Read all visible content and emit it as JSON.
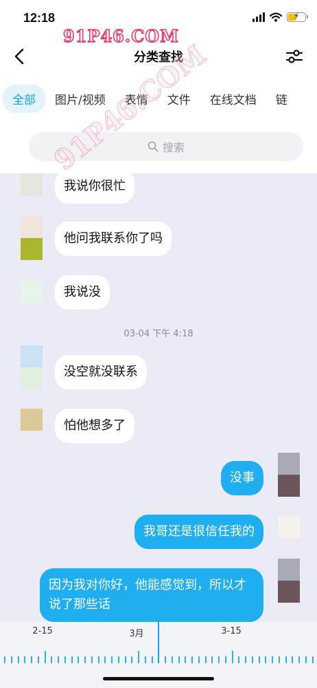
{
  "status_bar": {
    "time": "12:18"
  },
  "watermark": "91P46.COM",
  "header": {
    "title": "分类查找"
  },
  "tabs": [
    {
      "label": "全部",
      "active": true
    },
    {
      "label": "图片/视频"
    },
    {
      "label": "表情"
    },
    {
      "label": "文件"
    },
    {
      "label": "在线文档"
    },
    {
      "label": "链"
    }
  ],
  "search": {
    "placeholder": "搜索"
  },
  "messages": [
    {
      "text": "我说你很忙",
      "from": "other"
    },
    {
      "text": "他问我联系你了吗",
      "from": "other"
    },
    {
      "text": "我说没",
      "from": "other"
    },
    {
      "timestamp": "03-04 下午 4:18"
    },
    {
      "text": "没空就没联系",
      "from": "other"
    },
    {
      "text": "怕他想多了",
      "from": "other"
    },
    {
      "text": "没事",
      "from": "me"
    },
    {
      "text": "我哥还是很信任我的",
      "from": "me"
    },
    {
      "text": "因为我对你好，他能感觉到，所以才说了那些话",
      "from": "me"
    }
  ],
  "timeline": {
    "labels": [
      "2-15",
      "3月",
      "3-15"
    ]
  },
  "colors": {
    "accent": "#1aa0e0",
    "sent_bubble": "#1faef0",
    "chat_bg": "#ebebf5"
  }
}
